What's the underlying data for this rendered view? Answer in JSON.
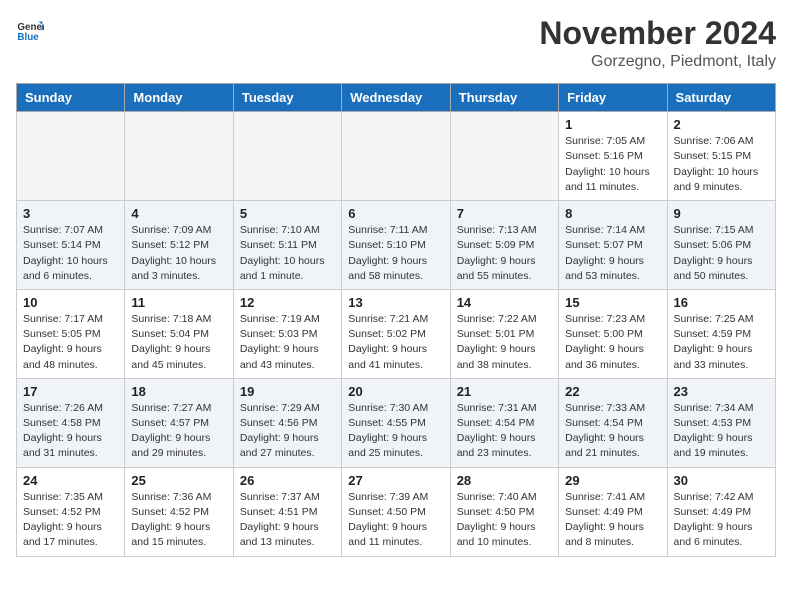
{
  "logo": {
    "general": "General",
    "blue": "Blue"
  },
  "header": {
    "month": "November 2024",
    "location": "Gorzegno, Piedmont, Italy"
  },
  "weekdays": [
    "Sunday",
    "Monday",
    "Tuesday",
    "Wednesday",
    "Thursday",
    "Friday",
    "Saturday"
  ],
  "rows": [
    {
      "shaded": false,
      "cells": [
        {
          "empty": true,
          "day": "",
          "info": ""
        },
        {
          "empty": true,
          "day": "",
          "info": ""
        },
        {
          "empty": true,
          "day": "",
          "info": ""
        },
        {
          "empty": true,
          "day": "",
          "info": ""
        },
        {
          "empty": true,
          "day": "",
          "info": ""
        },
        {
          "empty": false,
          "day": "1",
          "info": "Sunrise: 7:05 AM\nSunset: 5:16 PM\nDaylight: 10 hours\nand 11 minutes."
        },
        {
          "empty": false,
          "day": "2",
          "info": "Sunrise: 7:06 AM\nSunset: 5:15 PM\nDaylight: 10 hours\nand 9 minutes."
        }
      ]
    },
    {
      "shaded": true,
      "cells": [
        {
          "empty": false,
          "day": "3",
          "info": "Sunrise: 7:07 AM\nSunset: 5:14 PM\nDaylight: 10 hours\nand 6 minutes."
        },
        {
          "empty": false,
          "day": "4",
          "info": "Sunrise: 7:09 AM\nSunset: 5:12 PM\nDaylight: 10 hours\nand 3 minutes."
        },
        {
          "empty": false,
          "day": "5",
          "info": "Sunrise: 7:10 AM\nSunset: 5:11 PM\nDaylight: 10 hours\nand 1 minute."
        },
        {
          "empty": false,
          "day": "6",
          "info": "Sunrise: 7:11 AM\nSunset: 5:10 PM\nDaylight: 9 hours\nand 58 minutes."
        },
        {
          "empty": false,
          "day": "7",
          "info": "Sunrise: 7:13 AM\nSunset: 5:09 PM\nDaylight: 9 hours\nand 55 minutes."
        },
        {
          "empty": false,
          "day": "8",
          "info": "Sunrise: 7:14 AM\nSunset: 5:07 PM\nDaylight: 9 hours\nand 53 minutes."
        },
        {
          "empty": false,
          "day": "9",
          "info": "Sunrise: 7:15 AM\nSunset: 5:06 PM\nDaylight: 9 hours\nand 50 minutes."
        }
      ]
    },
    {
      "shaded": false,
      "cells": [
        {
          "empty": false,
          "day": "10",
          "info": "Sunrise: 7:17 AM\nSunset: 5:05 PM\nDaylight: 9 hours\nand 48 minutes."
        },
        {
          "empty": false,
          "day": "11",
          "info": "Sunrise: 7:18 AM\nSunset: 5:04 PM\nDaylight: 9 hours\nand 45 minutes."
        },
        {
          "empty": false,
          "day": "12",
          "info": "Sunrise: 7:19 AM\nSunset: 5:03 PM\nDaylight: 9 hours\nand 43 minutes."
        },
        {
          "empty": false,
          "day": "13",
          "info": "Sunrise: 7:21 AM\nSunset: 5:02 PM\nDaylight: 9 hours\nand 41 minutes."
        },
        {
          "empty": false,
          "day": "14",
          "info": "Sunrise: 7:22 AM\nSunset: 5:01 PM\nDaylight: 9 hours\nand 38 minutes."
        },
        {
          "empty": false,
          "day": "15",
          "info": "Sunrise: 7:23 AM\nSunset: 5:00 PM\nDaylight: 9 hours\nand 36 minutes."
        },
        {
          "empty": false,
          "day": "16",
          "info": "Sunrise: 7:25 AM\nSunset: 4:59 PM\nDaylight: 9 hours\nand 33 minutes."
        }
      ]
    },
    {
      "shaded": true,
      "cells": [
        {
          "empty": false,
          "day": "17",
          "info": "Sunrise: 7:26 AM\nSunset: 4:58 PM\nDaylight: 9 hours\nand 31 minutes."
        },
        {
          "empty": false,
          "day": "18",
          "info": "Sunrise: 7:27 AM\nSunset: 4:57 PM\nDaylight: 9 hours\nand 29 minutes."
        },
        {
          "empty": false,
          "day": "19",
          "info": "Sunrise: 7:29 AM\nSunset: 4:56 PM\nDaylight: 9 hours\nand 27 minutes."
        },
        {
          "empty": false,
          "day": "20",
          "info": "Sunrise: 7:30 AM\nSunset: 4:55 PM\nDaylight: 9 hours\nand 25 minutes."
        },
        {
          "empty": false,
          "day": "21",
          "info": "Sunrise: 7:31 AM\nSunset: 4:54 PM\nDaylight: 9 hours\nand 23 minutes."
        },
        {
          "empty": false,
          "day": "22",
          "info": "Sunrise: 7:33 AM\nSunset: 4:54 PM\nDaylight: 9 hours\nand 21 minutes."
        },
        {
          "empty": false,
          "day": "23",
          "info": "Sunrise: 7:34 AM\nSunset: 4:53 PM\nDaylight: 9 hours\nand 19 minutes."
        }
      ]
    },
    {
      "shaded": false,
      "cells": [
        {
          "empty": false,
          "day": "24",
          "info": "Sunrise: 7:35 AM\nSunset: 4:52 PM\nDaylight: 9 hours\nand 17 minutes."
        },
        {
          "empty": false,
          "day": "25",
          "info": "Sunrise: 7:36 AM\nSunset: 4:52 PM\nDaylight: 9 hours\nand 15 minutes."
        },
        {
          "empty": false,
          "day": "26",
          "info": "Sunrise: 7:37 AM\nSunset: 4:51 PM\nDaylight: 9 hours\nand 13 minutes."
        },
        {
          "empty": false,
          "day": "27",
          "info": "Sunrise: 7:39 AM\nSunset: 4:50 PM\nDaylight: 9 hours\nand 11 minutes."
        },
        {
          "empty": false,
          "day": "28",
          "info": "Sunrise: 7:40 AM\nSunset: 4:50 PM\nDaylight: 9 hours\nand 10 minutes."
        },
        {
          "empty": false,
          "day": "29",
          "info": "Sunrise: 7:41 AM\nSunset: 4:49 PM\nDaylight: 9 hours\nand 8 minutes."
        },
        {
          "empty": false,
          "day": "30",
          "info": "Sunrise: 7:42 AM\nSunset: 4:49 PM\nDaylight: 9 hours\nand 6 minutes."
        }
      ]
    }
  ]
}
